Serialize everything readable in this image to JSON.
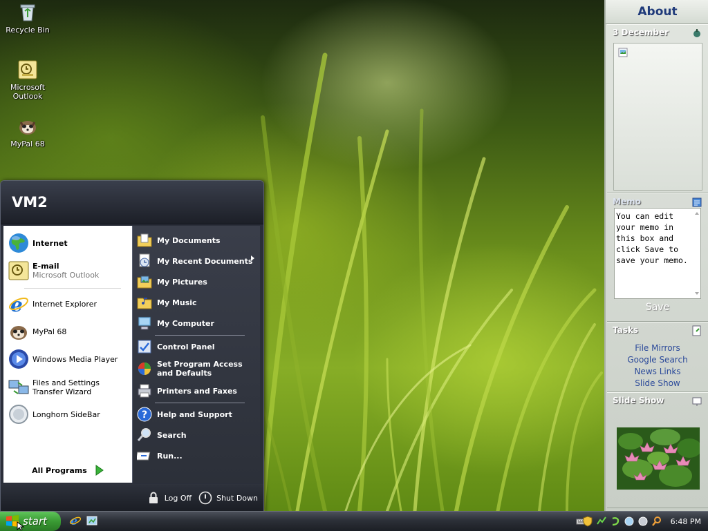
{
  "desktop": {
    "icons": [
      {
        "label": "Recycle Bin",
        "icon": "recycle-bin-icon"
      },
      {
        "label": "Microsoft Outlook",
        "icon": "outlook-icon"
      },
      {
        "label": "MyPal 68",
        "icon": "mypal-icon"
      }
    ]
  },
  "start_menu": {
    "user": "VM2",
    "left": {
      "internet": {
        "title": "Internet",
        "icon": "globe-icon"
      },
      "email": {
        "title": "E-mail",
        "subtitle": "Microsoft Outlook",
        "icon": "outlook-icon"
      },
      "programs": [
        {
          "label": "Internet Explorer",
          "icon": "internet-explorer-icon"
        },
        {
          "label": "MyPal 68",
          "icon": "mypal-icon"
        },
        {
          "label": "Windows Media Player",
          "icon": "media-player-icon"
        },
        {
          "label": "Files and Settings Transfer Wizard",
          "icon": "transfer-wizard-icon"
        },
        {
          "label": "Longhorn SideBar",
          "icon": "sidebar-icon"
        }
      ],
      "all_programs": "All Programs"
    },
    "right": {
      "items": [
        {
          "label": "My Documents",
          "icon": "folder-documents-icon"
        },
        {
          "label": "My Recent Documents",
          "icon": "recent-documents-icon"
        },
        {
          "label": "My Pictures",
          "icon": "folder-pictures-icon"
        },
        {
          "label": "My Music",
          "icon": "folder-music-icon"
        },
        {
          "label": "My Computer",
          "icon": "computer-icon"
        },
        {
          "label": "Control Panel",
          "icon": "control-panel-icon"
        },
        {
          "label": "Set Program Access and Defaults",
          "icon": "program-defaults-icon"
        },
        {
          "label": "Printers and Faxes",
          "icon": "printer-icon"
        },
        {
          "label": "Help and Support",
          "icon": "help-icon"
        },
        {
          "label": "Search",
          "icon": "search-icon"
        },
        {
          "label": "Run...",
          "icon": "run-icon"
        }
      ]
    },
    "footer": {
      "log_off": "Log Off",
      "shut_down": "Shut Down"
    }
  },
  "taskbar": {
    "start_label": "start",
    "clock": "6:48 PM"
  },
  "sidebar": {
    "title": "About",
    "calendar": {
      "title": "3 December"
    },
    "memo": {
      "title": "Memo",
      "text": "You can edit your memo in this box and click Save to save your memo.",
      "save_label": "Save"
    },
    "tasks": {
      "title": "Tasks",
      "links": [
        "File Mirrors",
        "Google Search",
        "News Links",
        "Slide Show"
      ]
    },
    "slideshow": {
      "title": "Slide Show"
    }
  },
  "colors": {
    "taskbar_dark": "#1c1f25",
    "start_green": "#3a9a34",
    "sidebar_link": "#2b4a9a",
    "sidebar_title": "#1f3a7a"
  }
}
